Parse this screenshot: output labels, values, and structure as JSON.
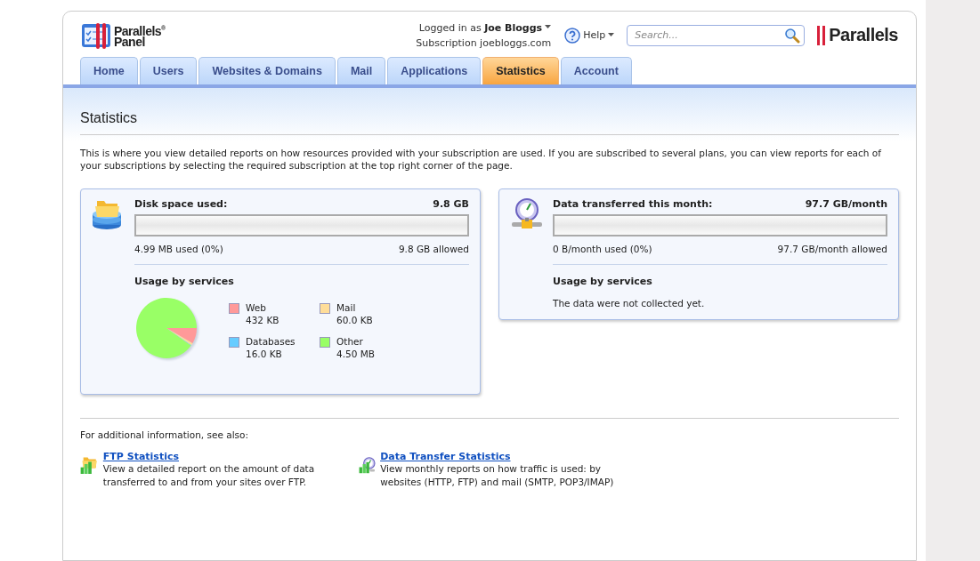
{
  "header": {
    "logo": {
      "line1": "Parallels",
      "mark": "®",
      "line2": "Panel"
    },
    "login_label": "Logged in as",
    "user": "Joe Bloggs",
    "subscription_label": "Subscription",
    "subscription": "joebloggs.com",
    "help": "Help",
    "search": {
      "placeholder": "Search..."
    },
    "brand": "Parallels"
  },
  "tabs": [
    {
      "label": "Home",
      "selected": false
    },
    {
      "label": "Users",
      "selected": false
    },
    {
      "label": "Websites & Domains",
      "selected": false
    },
    {
      "label": "Mail",
      "selected": false
    },
    {
      "label": "Applications",
      "selected": false
    },
    {
      "label": "Statistics",
      "selected": true
    },
    {
      "label": "Account",
      "selected": false
    }
  ],
  "page": {
    "title": "Statistics",
    "description": "This is where you view detailed reports on how resources provided with your subscription are used. If you are subscribed to several plans, you can view reports for each of your subscriptions by selecting the required subscription at the top right corner of the page."
  },
  "cards": [
    {
      "kind": "disk",
      "title": "Disk space used:",
      "total": "9.8 GB",
      "level": 0,
      "used": "4.99 MB used (0%)",
      "allowed": "9.8 GB allowed",
      "usage_title": "Usage by services",
      "chart_data": {
        "type": "pie",
        "values": [
          8.44,
          1.17,
          0.31,
          90.08
        ]
      },
      "legend": [
        {
          "label": "Web",
          "value": "432 KB",
          "color": "#ff9999"
        },
        {
          "label": "Mail",
          "value": "60.0 KB",
          "color": "#ffdd99"
        },
        {
          "label": "Databases",
          "value": "16.0 KB",
          "color": "#66ccff"
        },
        {
          "label": "Other",
          "value": "4.50 MB",
          "color": "#99ff66"
        }
      ]
    },
    {
      "kind": "traffic",
      "title": "Data transferred this month:",
      "total": "97.7 GB/month",
      "level": 0,
      "used": "0 B/month used (0%)",
      "allowed": "97.7 GB/month allowed",
      "usage_title": "Usage by services",
      "note": "The data were not collected yet."
    }
  ],
  "see_also": {
    "intro": "For additional information, see also:",
    "links": [
      {
        "kind": "ftp",
        "title": "FTP Statistics",
        "text": "View a detailed report on the amount of data transferred to and from your sites over FTP."
      },
      {
        "kind": "traffic",
        "title": "Data Transfer Statistics",
        "text": "View monthly reports on how traffic is used: by websites (HTTP, FTP) and mail (SMTP, POP3/IMAP)"
      }
    ]
  }
}
